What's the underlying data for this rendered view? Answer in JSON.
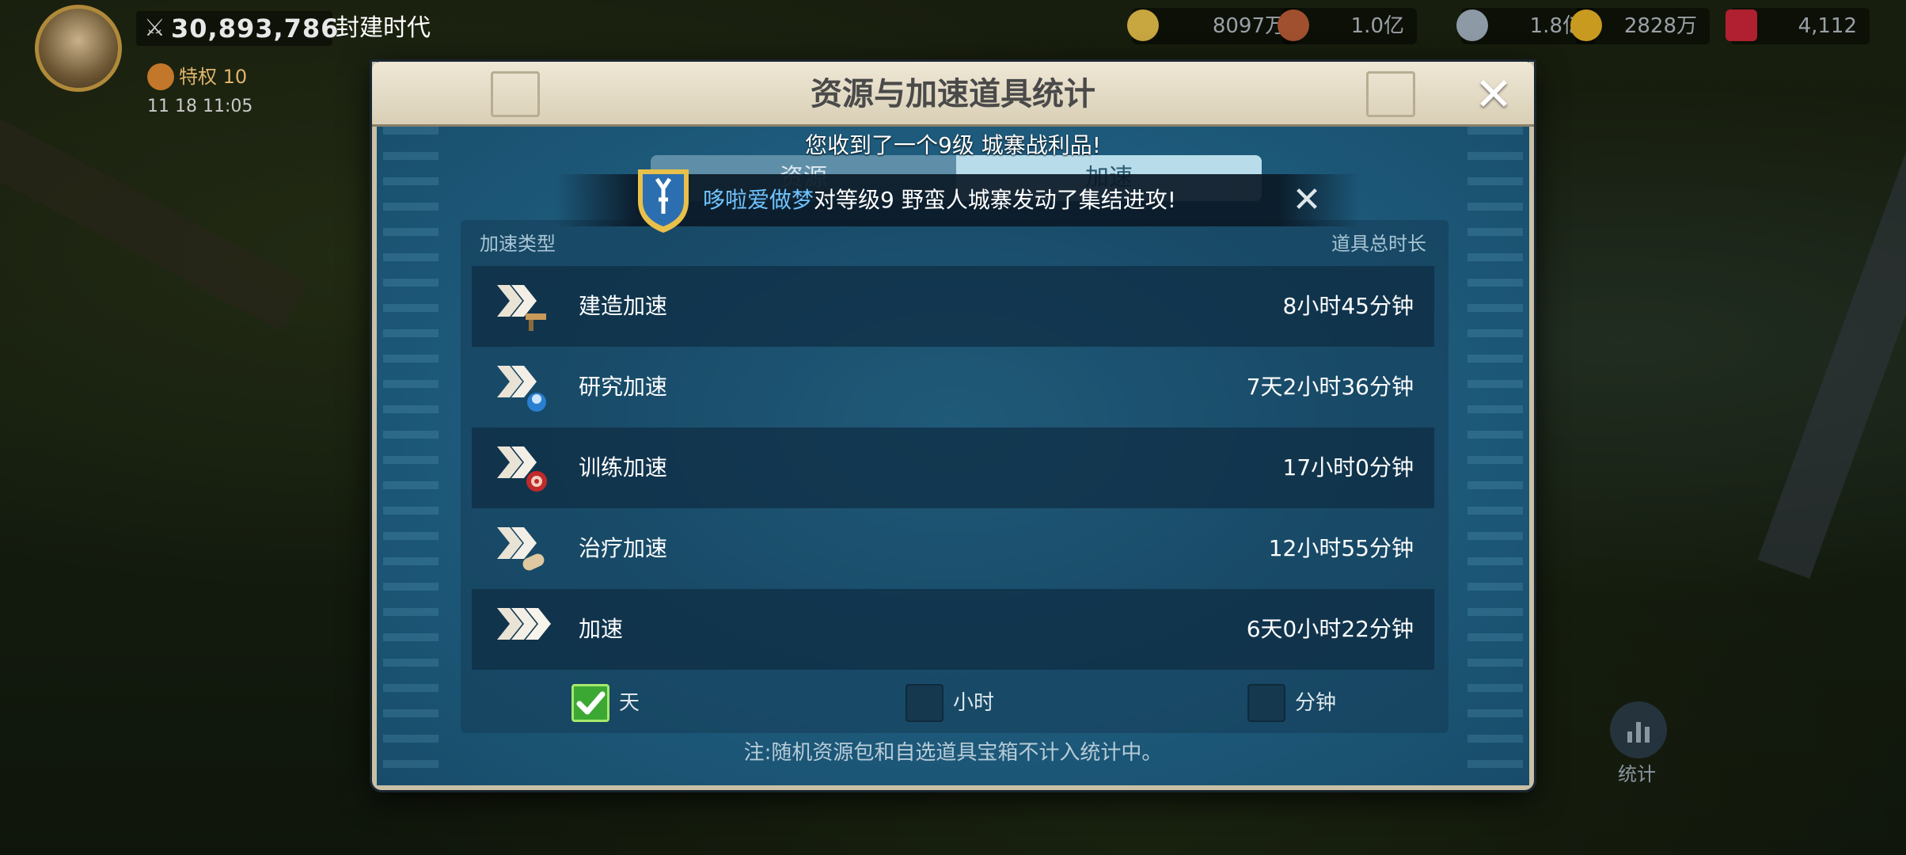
{
  "hud": {
    "power": "30,893,786",
    "era": "封建时代",
    "vip": "特权 10",
    "coords": "11 18 11:05",
    "resources": {
      "food": "8097万",
      "wood": "1.0亿",
      "stone": "1.8亿",
      "gold": "2828万",
      "gems": "4,112"
    },
    "stats_label": "统计"
  },
  "modal": {
    "title": "资源与加速道具统计",
    "tabs": [
      "资源",
      "加速"
    ],
    "active_tab": "加速",
    "notification": {
      "line1": "您收到了一个9级 城寨战利品!",
      "player": "哆啦爱做梦",
      "message": "对等级9 野蛮人城寨发动了集结进攻!"
    },
    "table": {
      "header_type": "加速类型",
      "header_total": "道具总时长",
      "rows": [
        {
          "name": "建造加速",
          "duration": "8小时45分钟",
          "icon": "build-speedup-icon"
        },
        {
          "name": "研究加速",
          "duration": "7天2小时36分钟",
          "icon": "research-speedup-icon"
        },
        {
          "name": "训练加速",
          "duration": "17小时0分钟",
          "icon": "training-speedup-icon"
        },
        {
          "name": "治疗加速",
          "duration": "12小时55分钟",
          "icon": "healing-speedup-icon"
        },
        {
          "name": "加速",
          "duration": "6天0小时22分钟",
          "icon": "universal-speedup-icon"
        }
      ]
    },
    "units": [
      {
        "label": "天",
        "checked": true
      },
      {
        "label": "小时",
        "checked": false
      },
      {
        "label": "分钟",
        "checked": false
      }
    ],
    "footnote": "注:随机资源包和自选道具宝箱不计入统计中。"
  }
}
